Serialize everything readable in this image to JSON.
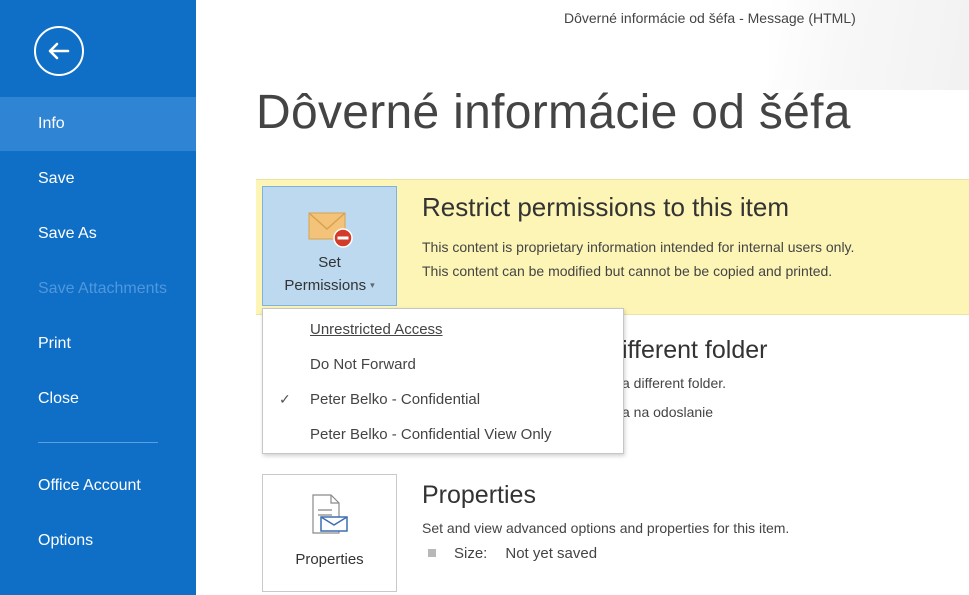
{
  "window": {
    "title": "Dôverné informácie od šéfa - Message (HTML)"
  },
  "page": {
    "title": "Dôverné informácie od šéfa"
  },
  "sidebar": {
    "items": [
      {
        "label": "Info"
      },
      {
        "label": "Save"
      },
      {
        "label": "Save As"
      },
      {
        "label": "Save Attachments"
      },
      {
        "label": "Print"
      },
      {
        "label": "Close"
      },
      {
        "label": "Office Account"
      },
      {
        "label": "Options"
      }
    ]
  },
  "permissions": {
    "button_line1": "Set",
    "button_line2": "Permissions",
    "heading": "Restrict permissions to this item",
    "line1": "This content is proprietary information intended for internal users only.",
    "line2": "This content can be modified but cannot be be copied and printed."
  },
  "dropdown": {
    "items": [
      {
        "label": "Unrestricted Access",
        "checked": false
      },
      {
        "label": "Do Not Forward",
        "checked": false
      },
      {
        "label": "Peter Belko - Confidential",
        "checked": true
      },
      {
        "label": "Peter Belko - Confidential View Only",
        "checked": false
      }
    ],
    "check_glyph": "✓"
  },
  "move": {
    "heading_visible": "ifferent folder",
    "line1_visible": "a different folder.",
    "line2_visible": "a na odoslanie"
  },
  "properties": {
    "button_label": "Properties",
    "heading": "Properties",
    "description": "Set and view advanced options and properties for this item.",
    "size_label": "Size:",
    "size_value": "Not yet saved"
  },
  "colors": {
    "sidebar_bg": "#0f6fc6",
    "sidebar_active": "#2f85d4",
    "banner_bg": "#fcf5b6",
    "button_selected": "#bcd9ef"
  }
}
